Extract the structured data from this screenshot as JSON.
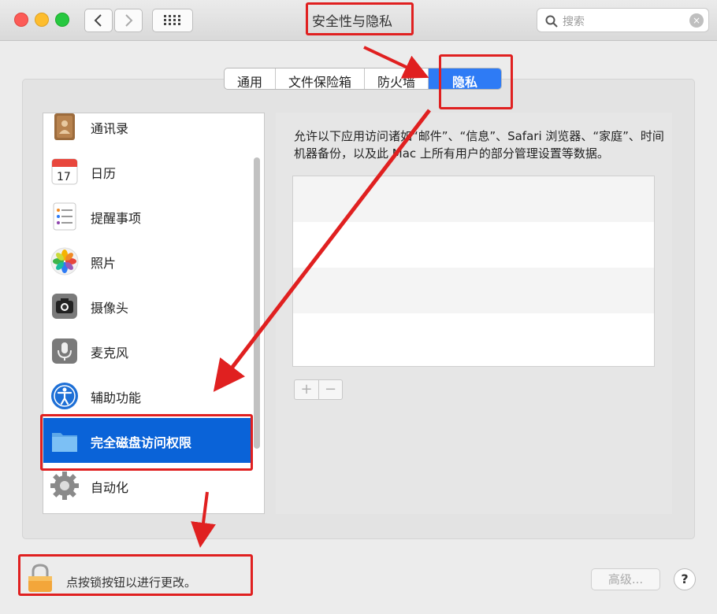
{
  "window": {
    "title": "安全性与隐私",
    "search_placeholder": "搜索"
  },
  "tabs": [
    {
      "label": "通用",
      "active": false
    },
    {
      "label": "文件保险箱",
      "active": false
    },
    {
      "label": "防火墙",
      "active": false
    },
    {
      "label": "隐私",
      "active": true
    }
  ],
  "sidebar": {
    "items": [
      {
        "label": "通讯录",
        "icon": "contacts-icon"
      },
      {
        "label": "日历",
        "icon": "calendar-icon",
        "icon_text": "17"
      },
      {
        "label": "提醒事项",
        "icon": "reminders-icon"
      },
      {
        "label": "照片",
        "icon": "photos-icon"
      },
      {
        "label": "摄像头",
        "icon": "camera-icon"
      },
      {
        "label": "麦克风",
        "icon": "microphone-icon"
      },
      {
        "label": "辅助功能",
        "icon": "accessibility-icon"
      },
      {
        "label": "完全磁盘访问权限",
        "icon": "folder-icon",
        "selected": true
      },
      {
        "label": "自动化",
        "icon": "gear-icon"
      }
    ]
  },
  "detail": {
    "description": "允许以下应用访问诸如“邮件”、“信息”、Safari 浏览器、“家庭”、时间机器备份，以及此 Mac 上所有用户的部分管理设置等数据。",
    "add_label": "+",
    "remove_label": "−"
  },
  "footer": {
    "lock_text": "点按锁按钮以进行更改。",
    "advanced_label": "高级...",
    "help_label": "?"
  },
  "colors": {
    "accent": "#2e7bf5",
    "selection": "#0a63d8",
    "annotation": "#e02020"
  }
}
